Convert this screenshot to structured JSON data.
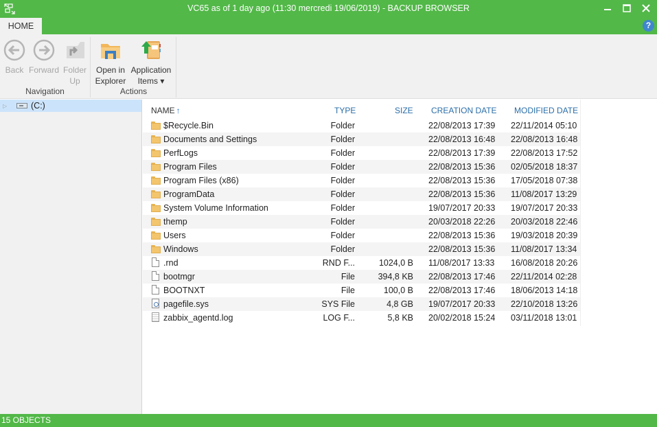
{
  "window": {
    "title": "VC65 as of 1 day ago (11:30 mercredi 19/06/2019) - BACKUP BROWSER",
    "icon": "backup-browser-icon",
    "controls": {
      "minimize": "—",
      "maximize": "☐",
      "close": "✕"
    }
  },
  "ribbon": {
    "tabs": [
      {
        "label": "HOME",
        "active": true
      }
    ],
    "help_label": "?",
    "groups": [
      {
        "label": "Navigation",
        "buttons": [
          {
            "line1": "Back",
            "line2": "",
            "icon": "back-arrow-icon",
            "enabled": false
          },
          {
            "line1": "Forward",
            "line2": "",
            "icon": "forward-arrow-icon",
            "enabled": false
          },
          {
            "line1": "Folder",
            "line2": "Up",
            "icon": "folder-up-icon",
            "enabled": false
          }
        ]
      },
      {
        "label": "Actions",
        "buttons": [
          {
            "line1": "Open in",
            "line2": "Explorer",
            "icon": "open-in-explorer-icon",
            "enabled": true
          },
          {
            "line1": "Application",
            "line2": "Items ▾",
            "icon": "application-items-icon",
            "enabled": true
          }
        ]
      }
    ]
  },
  "tree": {
    "items": [
      {
        "label": "(C:)",
        "icon": "drive-icon",
        "selected": true,
        "expander": "▷"
      }
    ]
  },
  "list": {
    "columns": {
      "name": "NAME",
      "name_sort": "↑",
      "type": "TYPE",
      "size": "SIZE",
      "created": "CREATION DATE",
      "modified": "MODIFIED DATE"
    },
    "rows": [
      {
        "kind": "folder",
        "name": "$Recycle.Bin",
        "type": "Folder",
        "size": "",
        "created": "22/08/2013 17:39",
        "modified": "22/11/2014 05:10"
      },
      {
        "kind": "folder",
        "name": "Documents and Settings",
        "type": "Folder",
        "size": "",
        "created": "22/08/2013 16:48",
        "modified": "22/08/2013 16:48"
      },
      {
        "kind": "folder",
        "name": "PerfLogs",
        "type": "Folder",
        "size": "",
        "created": "22/08/2013 17:39",
        "modified": "22/08/2013 17:52"
      },
      {
        "kind": "folder",
        "name": "Program Files",
        "type": "Folder",
        "size": "",
        "created": "22/08/2013 15:36",
        "modified": "02/05/2018 18:37"
      },
      {
        "kind": "folder",
        "name": "Program Files (x86)",
        "type": "Folder",
        "size": "",
        "created": "22/08/2013 15:36",
        "modified": "17/05/2018 07:38"
      },
      {
        "kind": "folder",
        "name": "ProgramData",
        "type": "Folder",
        "size": "",
        "created": "22/08/2013 15:36",
        "modified": "11/08/2017 13:29"
      },
      {
        "kind": "folder",
        "name": "System Volume Information",
        "type": "Folder",
        "size": "",
        "created": "19/07/2017 20:33",
        "modified": "19/07/2017 20:33"
      },
      {
        "kind": "folder",
        "name": "themp",
        "type": "Folder",
        "size": "",
        "created": "20/03/2018 22:26",
        "modified": "20/03/2018 22:46"
      },
      {
        "kind": "folder",
        "name": "Users",
        "type": "Folder",
        "size": "",
        "created": "22/08/2013 15:36",
        "modified": "19/03/2018 20:39"
      },
      {
        "kind": "folder",
        "name": "Windows",
        "type": "Folder",
        "size": "",
        "created": "22/08/2013 15:36",
        "modified": "11/08/2017 13:34"
      },
      {
        "kind": "file",
        "name": ".rnd",
        "type": "RND F...",
        "size": "1024,0 B",
        "created": "11/08/2017 13:33",
        "modified": "16/08/2018 20:26"
      },
      {
        "kind": "file",
        "name": "bootmgr",
        "type": "File",
        "size": "394,8 KB",
        "created": "22/08/2013 17:46",
        "modified": "22/11/2014 02:28"
      },
      {
        "kind": "file",
        "name": "BOOTNXT",
        "type": "File",
        "size": "100,0 B",
        "created": "22/08/2013 17:46",
        "modified": "18/06/2013 14:18"
      },
      {
        "kind": "sys",
        "name": "pagefile.sys",
        "type": "SYS File",
        "size": "4,8 GB",
        "created": "19/07/2017 20:33",
        "modified": "22/10/2018 13:26"
      },
      {
        "kind": "log",
        "name": "zabbix_agentd.log",
        "type": "LOG F...",
        "size": "5,8 KB",
        "created": "20/02/2018 15:24",
        "modified": "03/11/2018 13:01"
      }
    ]
  },
  "status": {
    "text": "15 OBJECTS"
  },
  "colors": {
    "accent": "#52b848",
    "header_text": "#2a6ea8",
    "selection": "#cce4fb",
    "ribbon_bg": "#f1f1f1"
  }
}
